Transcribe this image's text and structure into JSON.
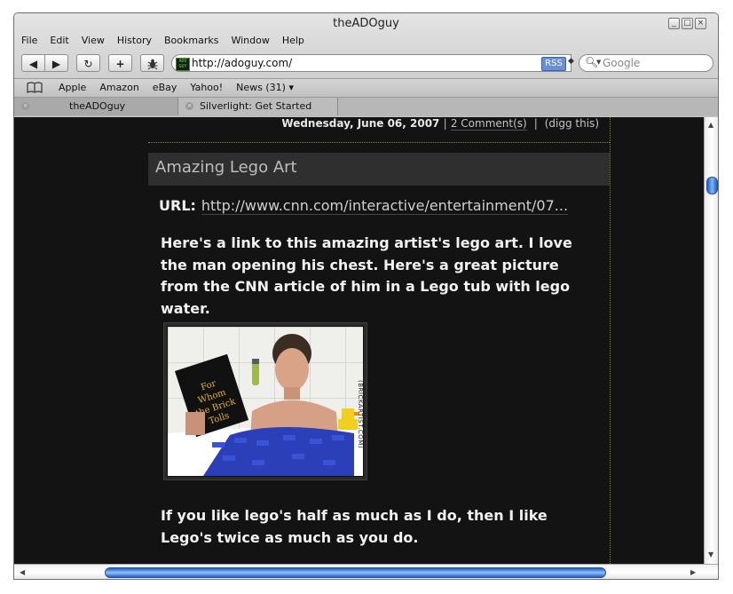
{
  "window": {
    "title": "theADOguy"
  },
  "menu": [
    "File",
    "Edit",
    "View",
    "History",
    "Bookmarks",
    "Window",
    "Help"
  ],
  "toolbar": {
    "back": "◀",
    "forward": "▶",
    "reload": "↻",
    "add": "+",
    "url": "http://adoguy.com/",
    "rss": "RSS",
    "search_placeholder": "Google"
  },
  "bookmarks": [
    "Apple",
    "Amazon",
    "eBay",
    "Yahoo!",
    "News (31) ▾"
  ],
  "tabs": [
    {
      "label": "theADOguy"
    },
    {
      "label": "Silverlight: Get Started"
    }
  ],
  "post": {
    "date": "Wednesday, June 06, 2007",
    "comments": "2 Comment(s)",
    "digg": "(digg this)",
    "title": "Amazing Lego Art",
    "url_label": "URL:",
    "url_value": "http://www.cnn.com/interactive/entertainment/07...",
    "body1": "Here's a link to this amazing artist's lego art.  I love the man opening his chest.  Here's a great picture from the CNN article of him in a Lego tub with lego water.",
    "body2": "If you like lego's half as much as I do, then I like Lego's twice as much as you do.",
    "image_book_text": "For Whom the Brick Tolls",
    "image_credit": "(BRICKARTIST.COM)"
  },
  "colors": {
    "content_bg": "#131313",
    "accent_dotted": "#7a8f3a",
    "scroll_thumb": "#1f5cc7",
    "rss": "#6b8fd6"
  },
  "icons": {
    "bookmarks": "open-book-icon",
    "search": "magnifier-icon",
    "favicon": "ado-guy-favicon",
    "tab_close": "close-icon"
  }
}
